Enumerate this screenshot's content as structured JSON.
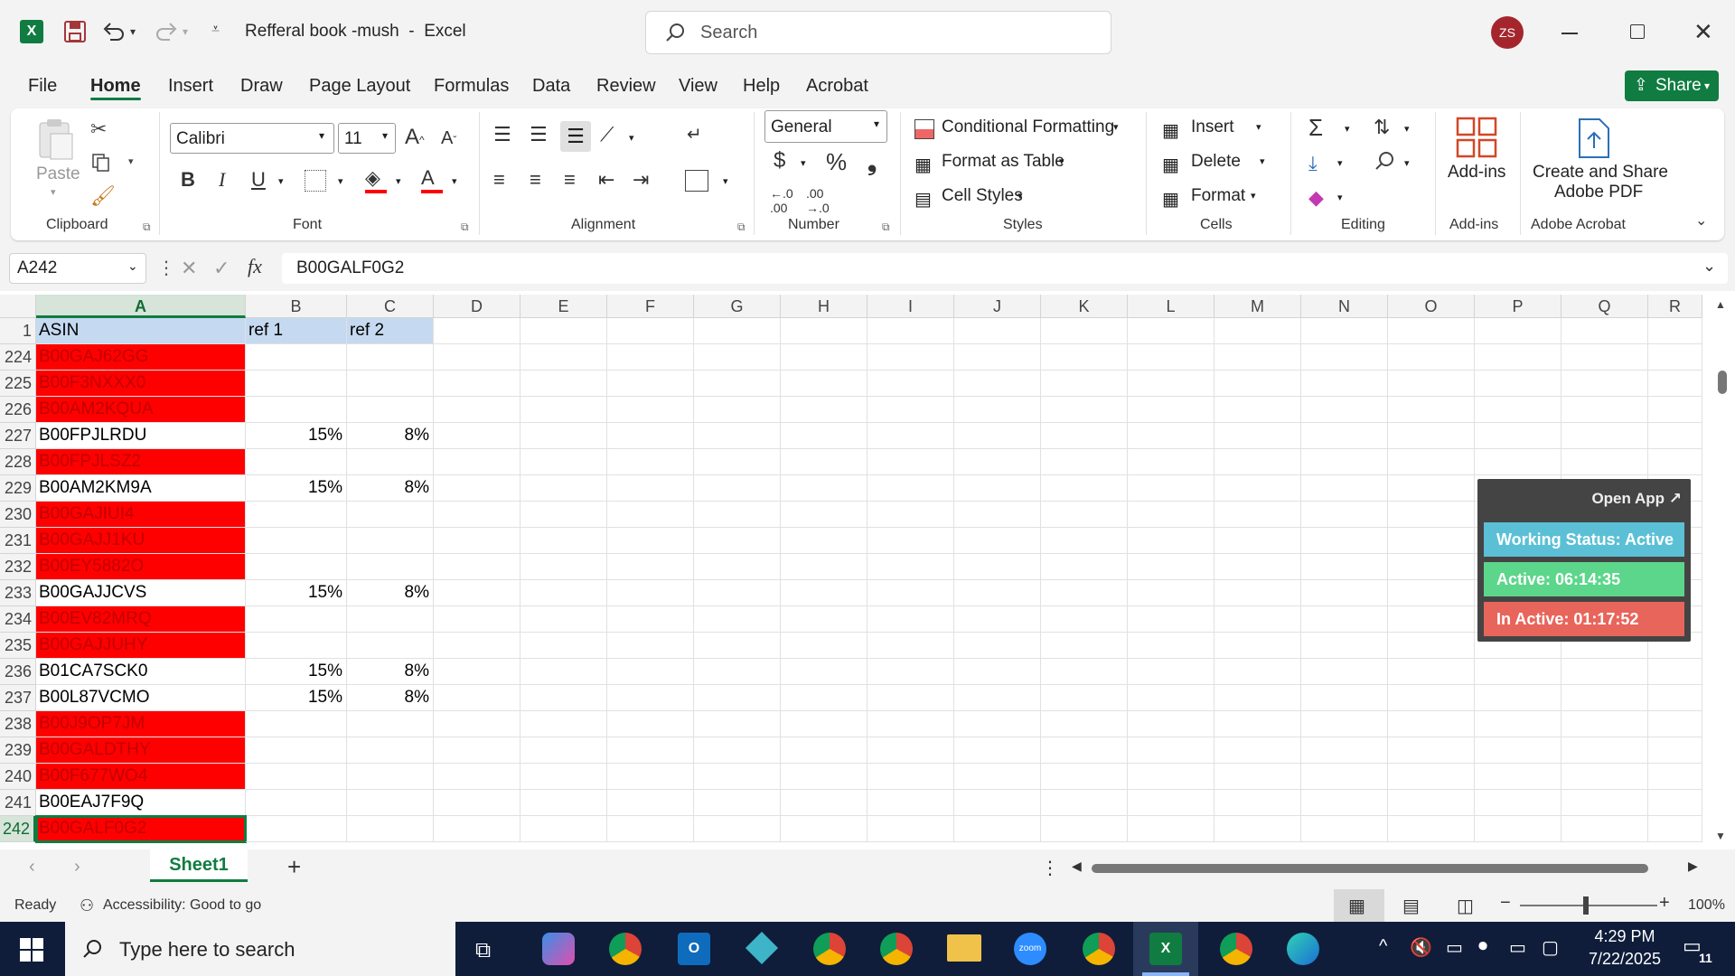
{
  "window": {
    "file_name": "Refferal book -mush",
    "app_name": "Excel",
    "search_placeholder": "Search",
    "avatar_initials": "ZS"
  },
  "menu": [
    "File",
    "Home",
    "Insert",
    "Draw",
    "Page Layout",
    "Formulas",
    "Data",
    "Review",
    "View",
    "Help",
    "Acrobat"
  ],
  "share_label": "Share",
  "ribbon": {
    "paste_label": "Paste",
    "font_name": "Calibri",
    "font_size": "11",
    "number_format": "General",
    "conditional_formatting": "Conditional Formatting",
    "format_as_table": "Format as Table",
    "cell_styles": "Cell Styles",
    "insert": "Insert",
    "delete": "Delete",
    "format": "Format",
    "addins_label": "Add-ins",
    "create_share_line1": "Create and Share",
    "create_share_line2": "Adobe PDF",
    "groups": {
      "clipboard": "Clipboard",
      "font": "Font",
      "alignment": "Alignment",
      "number": "Number",
      "styles": "Styles",
      "cells": "Cells",
      "editing": "Editing",
      "addins": "Add-ins",
      "adobe": "Adobe Acrobat"
    }
  },
  "formula_bar": {
    "name_box": "A242",
    "content": "B00GALF0G2"
  },
  "columns": [
    "A",
    "B",
    "C",
    "D",
    "E",
    "F",
    "G",
    "H",
    "I",
    "J",
    "K",
    "L",
    "M",
    "N",
    "O",
    "P",
    "Q",
    "R"
  ],
  "header_row": {
    "num": "1",
    "a": "ASIN",
    "b": "ref 1",
    "c": "ref 2"
  },
  "rows": [
    {
      "num": "224",
      "a": "B00GAJ62GG",
      "b": "",
      "c": "",
      "red": true
    },
    {
      "num": "225",
      "a": "B00F3NXXX0",
      "b": "",
      "c": "",
      "red": true
    },
    {
      "num": "226",
      "a": "B00AM2KQUA",
      "b": "",
      "c": "",
      "red": true
    },
    {
      "num": "227",
      "a": "B00FPJLRDU",
      "b": "15%",
      "c": "8%",
      "red": false
    },
    {
      "num": "228",
      "a": "B00FPJLSZ2",
      "b": "",
      "c": "",
      "red": true
    },
    {
      "num": "229",
      "a": "B00AM2KM9A",
      "b": "15%",
      "c": "8%",
      "red": false
    },
    {
      "num": "230",
      "a": "B00GAJIUI4",
      "b": "",
      "c": "",
      "red": true
    },
    {
      "num": "231",
      "a": "B00GAJJ1KU",
      "b": "",
      "c": "",
      "red": true
    },
    {
      "num": "232",
      "a": "B00EY5882O",
      "b": "",
      "c": "",
      "red": true
    },
    {
      "num": "233",
      "a": "B00GAJJCVS",
      "b": "15%",
      "c": "8%",
      "red": false
    },
    {
      "num": "234",
      "a": "B00EV82MRQ",
      "b": "",
      "c": "",
      "red": true
    },
    {
      "num": "235",
      "a": "B00GAJJUHY",
      "b": "",
      "c": "",
      "red": true
    },
    {
      "num": "236",
      "a": "B01CA7SCK0",
      "b": "15%",
      "c": "8%",
      "red": false
    },
    {
      "num": "237",
      "a": "B00L87VCMO",
      "b": "15%",
      "c": "8%",
      "red": false
    },
    {
      "num": "238",
      "a": "B00J9OP7JM",
      "b": "",
      "c": "",
      "red": true
    },
    {
      "num": "239",
      "a": "B00GALDTHY",
      "b": "",
      "c": "",
      "red": true
    },
    {
      "num": "240",
      "a": "B00F677WO4",
      "b": "",
      "c": "",
      "red": true
    },
    {
      "num": "241",
      "a": "B00EAJ7F9Q",
      "b": "",
      "c": "",
      "red": false
    },
    {
      "num": "242",
      "a": "B00GALF0G2",
      "b": "",
      "c": "",
      "red": true
    }
  ],
  "sheet_tab": "Sheet1",
  "status": {
    "ready": "Ready",
    "accessibility": "Accessibility: Good to go",
    "zoom": "100%"
  },
  "widget": {
    "open_app": "Open App ↗",
    "working_status": "Working Status: Active",
    "active": "Active: 06:14:35",
    "inactive": "In Active: 01:17:52"
  },
  "taskbar": {
    "search_placeholder": "Type here to search",
    "time": "4:29 PM",
    "date": "7/22/2025",
    "notification_count": "11"
  },
  "colors": {
    "excel_green": "#107c41",
    "red_fill": "#ff0000",
    "header_fill": "#c5d9f1",
    "widget_blue": "#5bc0d6",
    "widget_green": "#5cd68a",
    "widget_red": "#e8655b"
  }
}
